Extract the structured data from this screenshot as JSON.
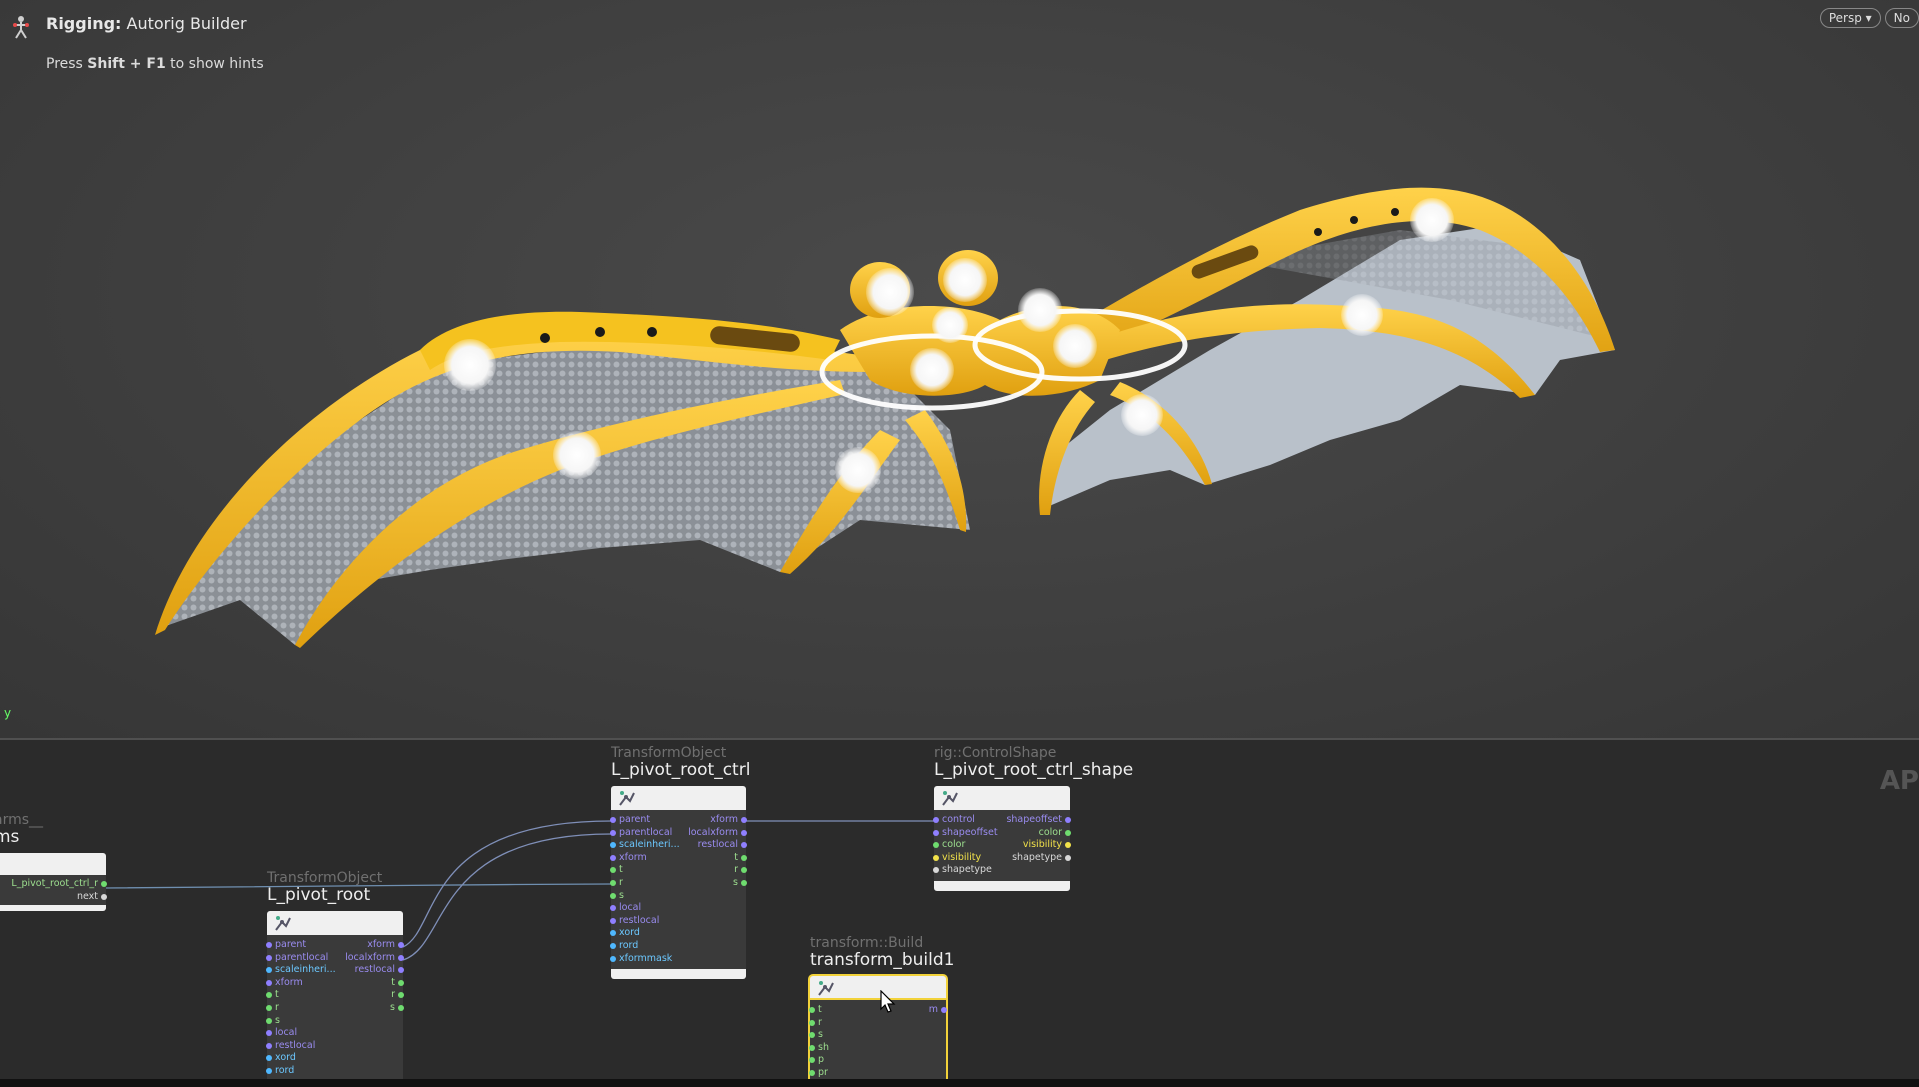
{
  "viewport": {
    "title_bold": "Rigging:",
    "title_rest": " Autorig Builder",
    "hint_pre": "Press ",
    "hint_keys": "Shift + F1",
    "hint_post": " to show hints",
    "camera_button": "Persp ▾",
    "display_button": "No",
    "axis_label": "y",
    "colors": {
      "wing_frame": "#f1b71f",
      "membrane": "#b8bec6",
      "background": "#404040"
    }
  },
  "network": {
    "side_label": "AP",
    "partial_node": {
      "type": "arms__",
      "name": "ms",
      "outputs": [
        "L_pivot_root_ctrl_r",
        "next"
      ]
    },
    "nodes": [
      {
        "type": "TransformObject",
        "name": "L_pivot_root",
        "inputs": [
          {
            "label": "parent",
            "color": "purple"
          },
          {
            "label": "parentlocal",
            "color": "purple"
          },
          {
            "label": "scaleinheri...",
            "color": "cyan"
          },
          {
            "label": "xform",
            "color": "purple"
          },
          {
            "label": "t",
            "color": "green"
          },
          {
            "label": "r",
            "color": "green"
          },
          {
            "label": "s",
            "color": "green"
          },
          {
            "label": "local",
            "color": "purple"
          },
          {
            "label": "restlocal",
            "color": "purple"
          },
          {
            "label": "xord",
            "color": "cyan"
          },
          {
            "label": "rord",
            "color": "cyan"
          }
        ],
        "outputs": [
          {
            "label": "xform",
            "color": "purple"
          },
          {
            "label": "localxform",
            "color": "purple"
          },
          {
            "label": "restlocal",
            "color": "purple"
          },
          {
            "label": "t",
            "color": "green"
          },
          {
            "label": "r",
            "color": "green"
          },
          {
            "label": "s",
            "color": "green"
          }
        ]
      },
      {
        "type": "TransformObject",
        "name": "L_pivot_root_ctrl",
        "inputs": [
          {
            "label": "parent",
            "color": "purple"
          },
          {
            "label": "parentlocal",
            "color": "purple"
          },
          {
            "label": "scaleinheri...",
            "color": "cyan"
          },
          {
            "label": "xform",
            "color": "purple"
          },
          {
            "label": "t",
            "color": "green"
          },
          {
            "label": "r",
            "color": "green"
          },
          {
            "label": "s",
            "color": "green"
          },
          {
            "label": "local",
            "color": "purple"
          },
          {
            "label": "restlocal",
            "color": "purple"
          },
          {
            "label": "xord",
            "color": "cyan"
          },
          {
            "label": "rord",
            "color": "cyan"
          },
          {
            "label": "xformmask",
            "color": "cyan"
          }
        ],
        "outputs": [
          {
            "label": "xform",
            "color": "purple"
          },
          {
            "label": "localxform",
            "color": "purple"
          },
          {
            "label": "restlocal",
            "color": "purple"
          },
          {
            "label": "t",
            "color": "green"
          },
          {
            "label": "r",
            "color": "green"
          },
          {
            "label": "s",
            "color": "green"
          }
        ]
      },
      {
        "type": "rig::ControlShape",
        "name": "L_pivot_root_ctrl_shape",
        "inputs": [
          {
            "label": "control",
            "color": "purple"
          },
          {
            "label": "shapeoffset",
            "color": "purple"
          },
          {
            "label": "color",
            "color": "green"
          },
          {
            "label": "visibility",
            "color": "yellow"
          },
          {
            "label": "shapetype",
            "color": "white"
          }
        ],
        "outputs": [
          {
            "label": "shapeoffset",
            "color": "purple"
          },
          {
            "label": "color",
            "color": "green"
          },
          {
            "label": "visibility",
            "color": "yellow"
          },
          {
            "label": "shapetype",
            "color": "white"
          }
        ]
      },
      {
        "type": "transform::Build",
        "name": "transform_build1",
        "inputs": [
          {
            "label": "t",
            "color": "green"
          },
          {
            "label": "r",
            "color": "green"
          },
          {
            "label": "s",
            "color": "green"
          },
          {
            "label": "sh",
            "color": "green"
          },
          {
            "label": "p",
            "color": "green"
          },
          {
            "label": "pr",
            "color": "green"
          }
        ],
        "outputs": [
          {
            "label": "m",
            "color": "purple"
          }
        ]
      }
    ]
  }
}
